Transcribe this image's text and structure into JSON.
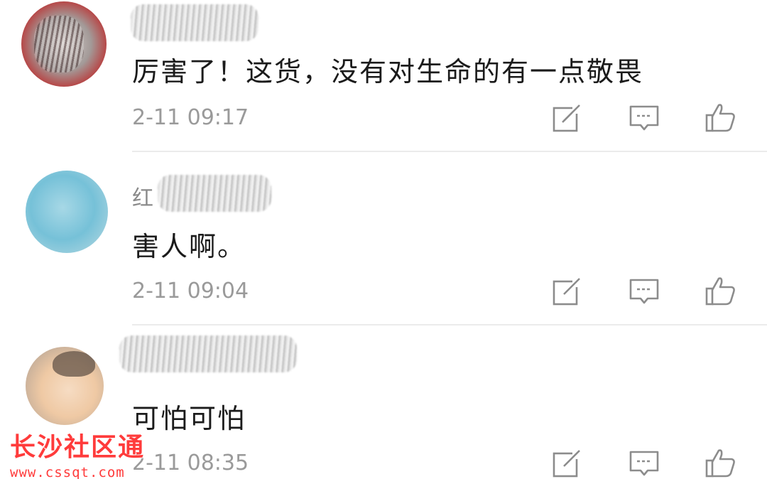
{
  "comments": [
    {
      "username": "",
      "text": "厉害了！这货，没有对生命的有一点敬畏",
      "time": "2-11 09:17"
    },
    {
      "username": "红",
      "text": "害人啊。",
      "time": "2-11 09:04"
    },
    {
      "username": "",
      "text": "可怕可怕",
      "time": "2-11 08:35"
    }
  ],
  "actions": {
    "edit_icon": "edit-icon",
    "reply_icon": "comment-icon",
    "like_icon": "thumbs-up-icon"
  },
  "watermark": {
    "title": "长沙社区通",
    "url": "www.cssqt.com"
  },
  "colors": {
    "text": "#1b1b1b",
    "meta": "#9a9a9a",
    "icon": "#8c8c8c",
    "watermark": "#ff3b3b"
  }
}
